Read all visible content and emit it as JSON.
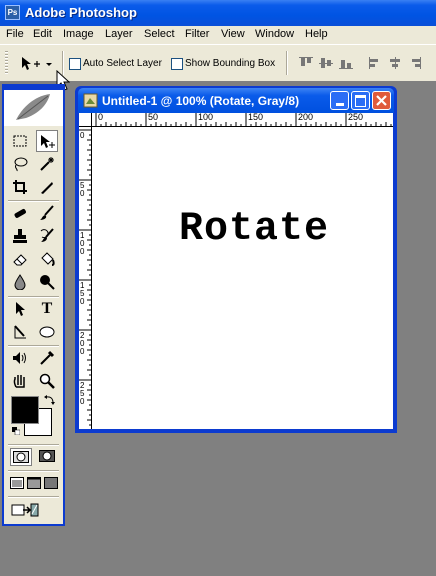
{
  "app": {
    "title": "Adobe Photoshop",
    "icon": "photoshop-app-icon"
  },
  "menu": [
    "File",
    "Edit",
    "Image",
    "Layer",
    "Select",
    "Filter",
    "View",
    "Window",
    "Help"
  ],
  "options": {
    "tool_icon": "move-tool-icon",
    "auto_select_label": "Auto Select Layer",
    "auto_select_checked": false,
    "bounding_box_label": "Show Bounding Box",
    "bounding_box_checked": false,
    "align_icons": [
      "align-top-edges-icon",
      "align-vertical-centers-icon",
      "align-bottom-edges-icon",
      "align-left-edges-icon",
      "align-horizontal-centers-icon",
      "align-right-edges-icon"
    ]
  },
  "toolbox": {
    "tools": [
      "rectangular-marquee-tool-icon",
      "move-tool-icon",
      "lasso-tool-icon",
      "magic-wand-tool-icon",
      "crop-tool-icon",
      "slice-tool-icon",
      "healing-brush-tool-icon",
      "brush-tool-icon",
      "clone-stamp-tool-icon",
      "history-brush-tool-icon",
      "eraser-tool-icon",
      "paint-bucket-tool-icon",
      "blur-tool-icon",
      "dodge-tool-icon",
      "path-selection-tool-icon",
      "type-tool-icon",
      "pen-tool-icon",
      "ellipse-tool-icon",
      "notes-tool-icon",
      "eyedropper-tool-icon",
      "hand-tool-icon",
      "zoom-tool-icon"
    ],
    "type_tool_glyph": "T",
    "foreground_color": "#000000",
    "background_color": "#ffffff"
  },
  "document": {
    "title": "Untitled-1 @ 100% (Rotate, Gray/8)",
    "canvas_text": "Rotate",
    "ruler_top_labels": [
      "0",
      "50",
      "100",
      "150",
      "200",
      "250"
    ],
    "ruler_left_labels": [
      "0",
      "5 0",
      "1 0 0",
      "1 5 0",
      "2 0 0",
      "2 5 0"
    ]
  },
  "colors": {
    "xp_blue": "#0054e3",
    "chrome": "#ece9d8",
    "workspace": "#808080",
    "close_red": "#e05a3b"
  }
}
